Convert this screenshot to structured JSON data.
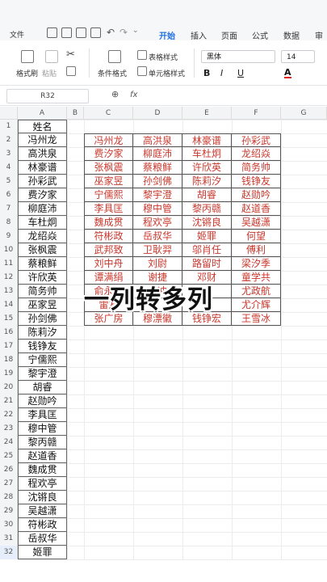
{
  "ribbon_tabs": {
    "file": "文件",
    "tabs": [
      "开始",
      "插入",
      "页面",
      "公式",
      "数据",
      "审阅"
    ],
    "active": "开始"
  },
  "toolbar": {
    "format_painter": "格式刷",
    "paste": "粘贴",
    "conditional_format": "条件格式",
    "table_style": "表格样式",
    "cell_style": "单元格样式",
    "font_name": "黑体",
    "font_size": "14",
    "bold": "B",
    "italic": "I",
    "underline": "U",
    "font_color": "A"
  },
  "formula_bar": {
    "name_box": "R32",
    "fx": "fx"
  },
  "columns": [
    "A",
    "B",
    "C",
    "D",
    "E",
    "F",
    "G"
  ],
  "column_a": {
    "rows": [
      "1",
      "2",
      "3",
      "4",
      "5",
      "6",
      "7",
      "8",
      "9",
      "10",
      "11",
      "12",
      "13",
      "14",
      "15",
      "16",
      "17",
      "18",
      "19",
      "20",
      "21",
      "22",
      "23",
      "24",
      "25",
      "26",
      "27",
      "28",
      "29",
      "30",
      "31",
      "32"
    ],
    "values": [
      "姓名",
      "冯州龙",
      "高洪泉",
      "林豪谱",
      "孙彩武",
      "费汐家",
      "柳庭沛",
      "车杜炯",
      "龙绍焱",
      "张枫震",
      "蔡粮鲜",
      "许欣英",
      "简务帅",
      "巫家昱",
      "孙剑佛",
      "陈莉汐",
      "钱铮友",
      "宁儒熙",
      "黎宇澄",
      "胡睿",
      "赵勋吟",
      "李具匡",
      "穆中管",
      "黎丙赣",
      "赵道香",
      "魏成贯",
      "程欢亭",
      "沈锵良",
      "吴越潇",
      "符彬政",
      "岳叔华",
      "姬罪"
    ]
  },
  "matrix": [
    [
      "冯州龙",
      "高洪泉",
      "林豪谱",
      "孙彩武"
    ],
    [
      "费汐家",
      "柳庭沛",
      "车杜炯",
      "龙绍焱"
    ],
    [
      "张枫震",
      "蔡粮鲜",
      "许欣英",
      "简务帅"
    ],
    [
      "巫家昱",
      "孙剑佛",
      "陈莉汐",
      "钱铮友"
    ],
    [
      "宁儒熙",
      "黎宇澄",
      "胡睿",
      "赵勋吟"
    ],
    [
      "李具匡",
      "穆中管",
      "黎丙赣",
      "赵道香"
    ],
    [
      "魏成贯",
      "程欢亭",
      "沈锵良",
      "吴越潇"
    ],
    [
      "符彬政",
      "岳叔华",
      "姬罪",
      "何望"
    ],
    [
      "武邦致",
      "卫耿羿",
      "邬肖任",
      "傅利"
    ],
    [
      "刘中舟",
      "刘尉",
      "路留时",
      "梁汐季"
    ],
    [
      "谭满绢",
      "谢捷",
      "邓财",
      "童学共"
    ],
    [
      "俞永鸿",
      "全冲",
      "",
      "尤政航"
    ],
    [
      "雷友",
      "",
      "",
      "尤介辉"
    ],
    [
      "张广房",
      "穆漂徽",
      "钱铮宏",
      "王雪冰"
    ]
  ],
  "overlay_title": "一列转多列"
}
